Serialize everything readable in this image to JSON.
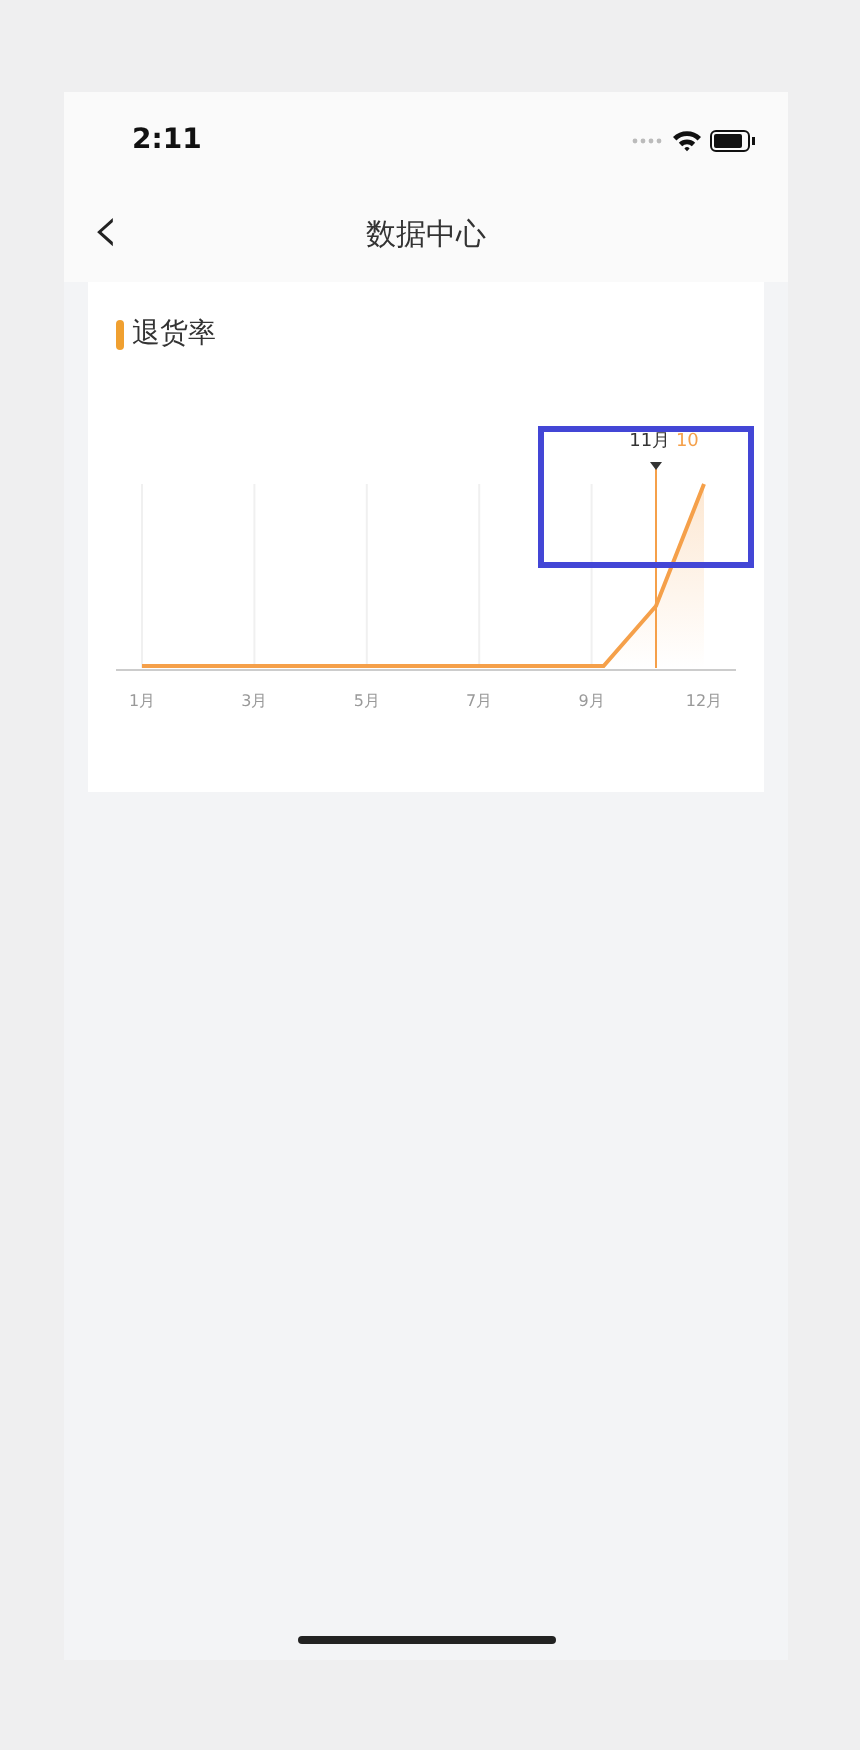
{
  "status_bar": {
    "time": "2:11"
  },
  "nav_bar": {
    "back": "‹",
    "title": "数据中心"
  },
  "card": {
    "title": "退货率",
    "chart": {
      "x_labels": [
        "1月",
        "3月",
        "5月",
        "7月",
        "9月",
        "12月"
      ],
      "tooltip": {
        "label": "11月",
        "value": "10"
      }
    }
  },
  "highlight": {
    "shown": true
  }
}
